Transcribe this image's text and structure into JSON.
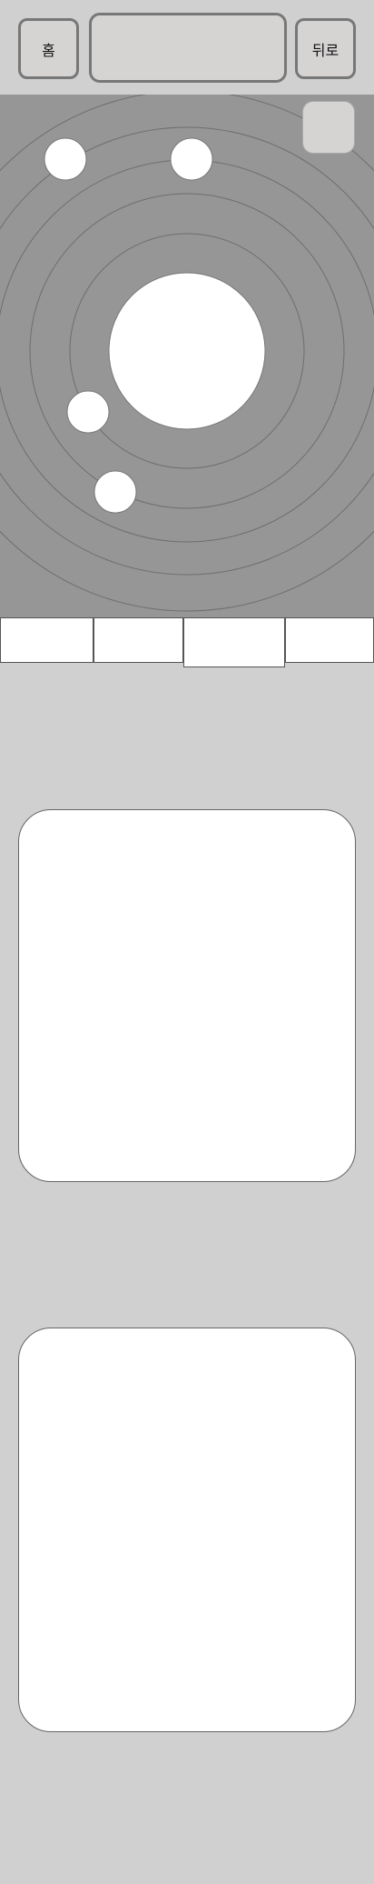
{
  "header": {
    "home_label": "홈",
    "title_text": "",
    "back_label": "뒤로"
  },
  "stage": {
    "background_color": "#969696",
    "orbit_count": 5,
    "planet_count": 4,
    "sun_color": "#ffffff"
  },
  "tabs": [
    {
      "label": "",
      "selected": false
    },
    {
      "label": "",
      "selected": false
    },
    {
      "label": "",
      "selected": true
    },
    {
      "label": "",
      "selected": false
    }
  ],
  "cards": [
    {
      "content": ""
    },
    {
      "content": ""
    }
  ]
}
